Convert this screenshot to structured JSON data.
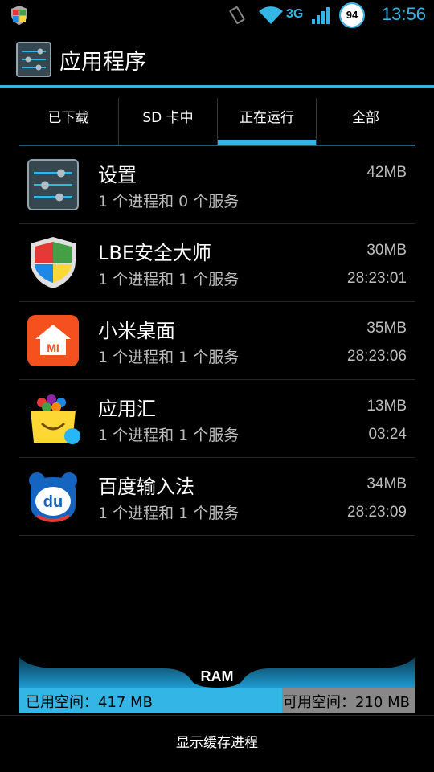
{
  "status_bar": {
    "network": "3G",
    "battery": "94",
    "time": "13:56"
  },
  "header": {
    "title": "应用程序"
  },
  "tabs": [
    {
      "label": "已下载"
    },
    {
      "label": "SD 卡中"
    },
    {
      "label": "正在运行"
    },
    {
      "label": "全部"
    }
  ],
  "selected_tab": "正在运行",
  "apps": [
    {
      "name": "设置",
      "desc": "1 个进程和 0 个服务",
      "size": "42MB",
      "time": "",
      "icon": "settings-icon"
    },
    {
      "name": "LBE安全大师",
      "desc": "1 个进程和 1 个服务",
      "size": "30MB",
      "time": "28:23:01",
      "icon": "shield-icon"
    },
    {
      "name": "小米桌面",
      "desc": "1 个进程和 1 个服务",
      "size": "35MB",
      "time": "28:23:06",
      "icon": "mi-home-icon"
    },
    {
      "name": "应用汇",
      "desc": "1 个进程和 1 个服务",
      "size": "13MB",
      "time": "03:24",
      "icon": "app-market-icon"
    },
    {
      "name": "百度输入法",
      "desc": "1 个进程和 1 个服务",
      "size": "34MB",
      "time": "28:23:09",
      "icon": "baidu-ime-icon"
    }
  ],
  "ram": {
    "label": "RAM",
    "used": "已用空间：417 MB",
    "free": "可用空间：210 MB",
    "used_fraction": 0.665
  },
  "footer": {
    "button": "显示缓存进程"
  },
  "colors": {
    "accent": "#33b5e5",
    "background": "#000000"
  }
}
